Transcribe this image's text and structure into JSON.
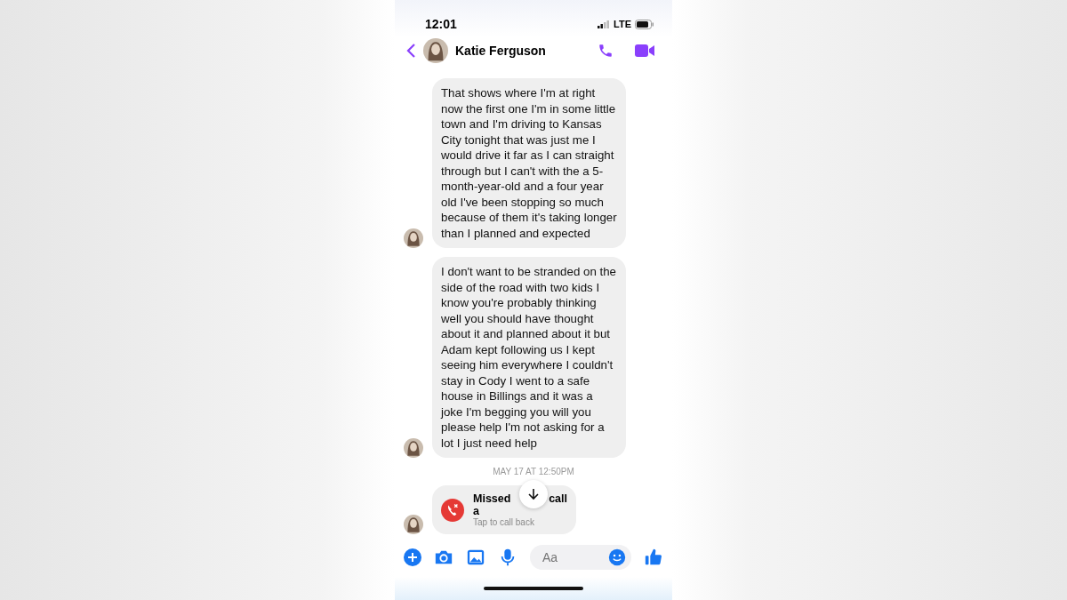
{
  "status_bar": {
    "time": "12:01",
    "network": "LTE"
  },
  "header": {
    "contact_name": "Katie Ferguson"
  },
  "messages": [
    {
      "kind": "text",
      "text": "That shows where I'm at right now the first one I'm in some little town and I'm driving to Kansas City tonight that was just me I would drive it far as I can straight through but I can't with the a 5-month-year-old and a four year old I've been stopping so much because of them it's taking longer than I planned and expected"
    },
    {
      "kind": "text",
      "text": "I don't want to be stranded on the side of the road with two kids I know you're probably thinking well you should have thought about it and planned about it but Adam kept following us I kept seeing him everywhere I couldn't stay in Cody I went to a safe house in Billings and it was a joke I'm begging you will you please help I'm not asking for a lot I just need help"
    },
    {
      "kind": "timestamp",
      "text": "MAY 17 AT 12:50PM"
    },
    {
      "kind": "missed_call",
      "title_start": "Missed a",
      "title_end": "call",
      "subtitle": "Tap to call back"
    }
  ],
  "composer": {
    "placeholder": "Aa"
  }
}
